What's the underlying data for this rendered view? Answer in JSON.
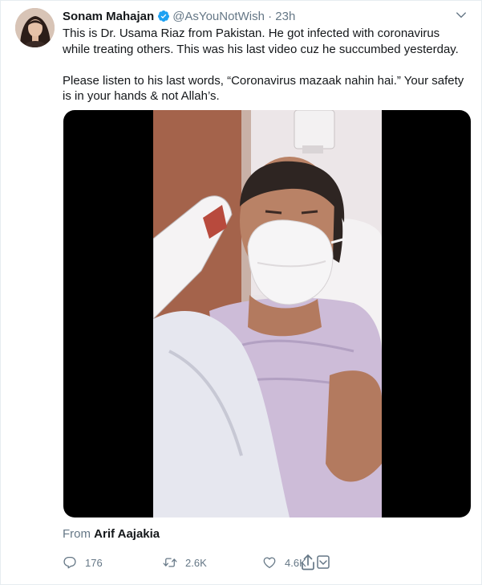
{
  "author": {
    "name": "Sonam Mahajan",
    "handle": "@AsYouNotWish",
    "separator": "·",
    "time": "23h"
  },
  "tweet": {
    "paragraph1": "This is Dr. Usama Riaz from Pakistan. He got infected with coronavirus while treating others. This was his last video cuz he succumbed yesterday.",
    "paragraph2": "Please listen to his last words, “Coronavirus mazaak nahin hai.” Your safety is in your hands & not Allah’s."
  },
  "attribution": {
    "prefix": "From",
    "source": "Arif Aajakia"
  },
  "actions": {
    "replies": "176",
    "retweets": "2.6K",
    "likes": "4.6K"
  },
  "icons": {
    "verified": "verified-badge-icon",
    "caret": "chevron-down-icon",
    "reply": "reply-icon",
    "retweet": "retweet-icon",
    "like": "heart-icon",
    "share": "share-icon"
  },
  "colors": {
    "verified": "#1da1f2",
    "secondary_text": "#657786",
    "primary_text": "#14171a"
  }
}
